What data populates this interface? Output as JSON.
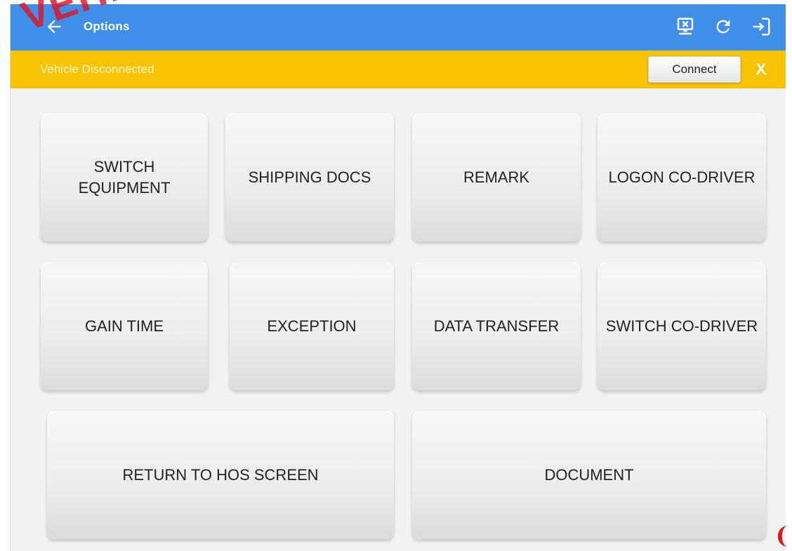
{
  "appbar": {
    "title": "Options",
    "color": "#3f8fe8",
    "icons": [
      "back-arrow-icon",
      "vehicle-disconnected-icon",
      "refresh-icon",
      "logout-icon"
    ]
  },
  "banner": {
    "message": "Vehicle Disconnected",
    "connect_label": "Connect",
    "dismiss_label": "X",
    "color": "#f8c300"
  },
  "tiles": [
    {
      "label": "SWITCH EQUIPMENT"
    },
    {
      "label": "SHIPPING DOCS"
    },
    {
      "label": "REMARK"
    },
    {
      "label": "LOGON CO-DRIVER"
    },
    {
      "label": "GAIN TIME"
    },
    {
      "label": "EXCEPTION"
    },
    {
      "label": "DATA TRANSFER"
    },
    {
      "label": "SWITCH CO-DRIVER"
    },
    {
      "label": "RETURN TO HOS SCREEN"
    },
    {
      "label": "DOCUMENT"
    }
  ],
  "watermark": {
    "text": "VEHICLE",
    "color": "#e21422"
  }
}
